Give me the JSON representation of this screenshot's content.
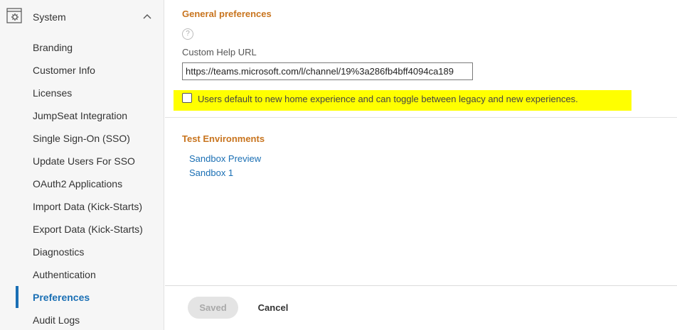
{
  "sidebar": {
    "section_label": "System",
    "section_icon": "system-settings-icon",
    "items": [
      {
        "label": "Branding"
      },
      {
        "label": "Customer Info"
      },
      {
        "label": "Licenses"
      },
      {
        "label": "JumpSeat Integration"
      },
      {
        "label": "Single Sign-On (SSO)"
      },
      {
        "label": "Update Users For SSO"
      },
      {
        "label": "OAuth2 Applications"
      },
      {
        "label": "Import Data (Kick-Starts)"
      },
      {
        "label": "Export Data (Kick-Starts)"
      },
      {
        "label": "Diagnostics"
      },
      {
        "label": "Authentication"
      },
      {
        "label": "Preferences",
        "active": true
      },
      {
        "label": "Audit Logs"
      }
    ]
  },
  "general": {
    "title": "General preferences",
    "help_icon": "?",
    "custom_help_url_label": "Custom Help URL",
    "custom_help_url_value": "https://teams.microsoft.com/l/channel/19%3a286fb4bff4094ca189",
    "home_experience_checkbox_label": "Users default to new home experience and can toggle between legacy and new experiences.",
    "home_experience_checked": false
  },
  "test_environments": {
    "title": "Test Environments",
    "links": [
      {
        "label": "Sandbox Preview"
      },
      {
        "label": "Sandbox 1"
      }
    ]
  },
  "footer": {
    "saved_label": "Saved",
    "cancel_label": "Cancel"
  },
  "colors": {
    "accent": "#1a6fb4",
    "section_title": "#c8741e",
    "highlight": "#ffff00"
  }
}
